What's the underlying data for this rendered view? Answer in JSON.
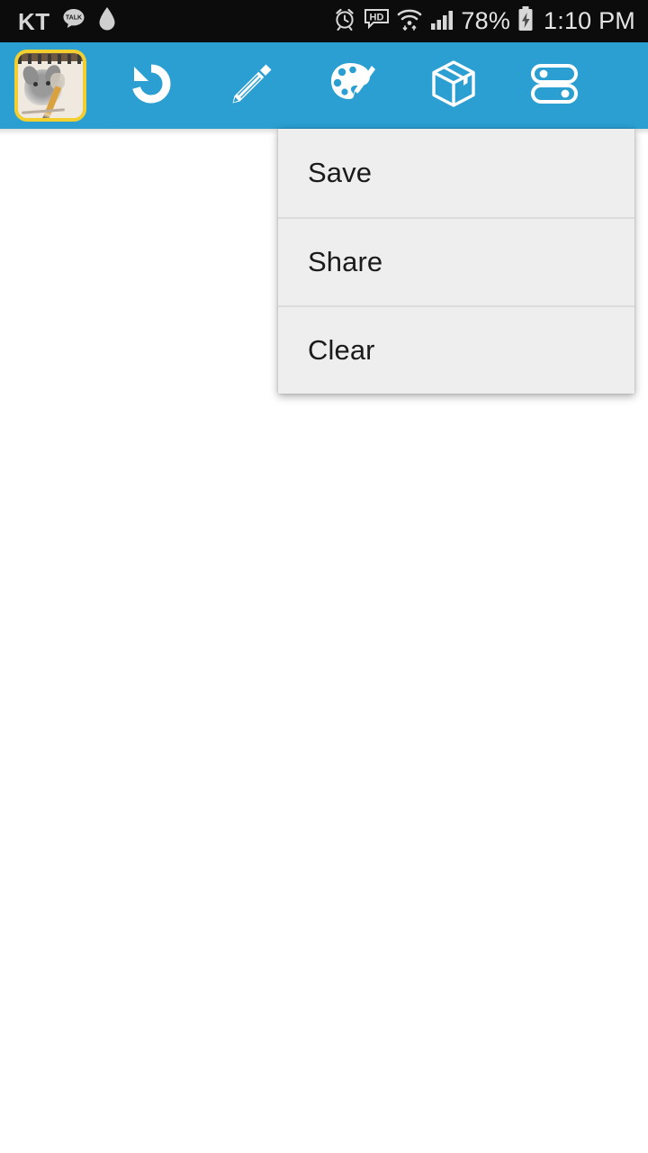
{
  "status_bar": {
    "carrier": "KT",
    "kakao_talk_label": "TALK",
    "battery_percent": "78%",
    "time": "1:10 PM",
    "icons": [
      "kakaotalk-icon",
      "water-drop-icon",
      "alarm-clock-icon",
      "hd-badge-icon",
      "wifi-icon",
      "signal-bars-icon",
      "battery-charging-icon"
    ],
    "background_color": "#0c0c0c",
    "text_color": "#e4e4e4"
  },
  "toolbar": {
    "background_color": "#2b9fd1",
    "icon_color": "#ffffff",
    "items": [
      {
        "name": "app-icon-button",
        "icon": "sketchpad-dog-drawing-icon",
        "label": ""
      },
      {
        "name": "undo-button",
        "icon": "undo-arrow-icon",
        "label": ""
      },
      {
        "name": "pencil-button",
        "icon": "pencil-icon",
        "label": ""
      },
      {
        "name": "palette-button",
        "icon": "palette-brush-icon",
        "label": ""
      },
      {
        "name": "shapes-button",
        "icon": "cube-box-icon",
        "label": ""
      },
      {
        "name": "settings-button",
        "icon": "toggle-sliders-icon",
        "label": ""
      }
    ]
  },
  "popup_menu": {
    "background_color": "#eeeeee",
    "divider_color": "#dcdcdc",
    "text_color": "#1b1b1b",
    "items": [
      {
        "label": "Save",
        "name": "menu-item-save"
      },
      {
        "label": "Share",
        "name": "menu-item-share"
      },
      {
        "label": "Clear",
        "name": "menu-item-clear"
      }
    ]
  },
  "canvas": {
    "background_color": "#ffffff"
  }
}
